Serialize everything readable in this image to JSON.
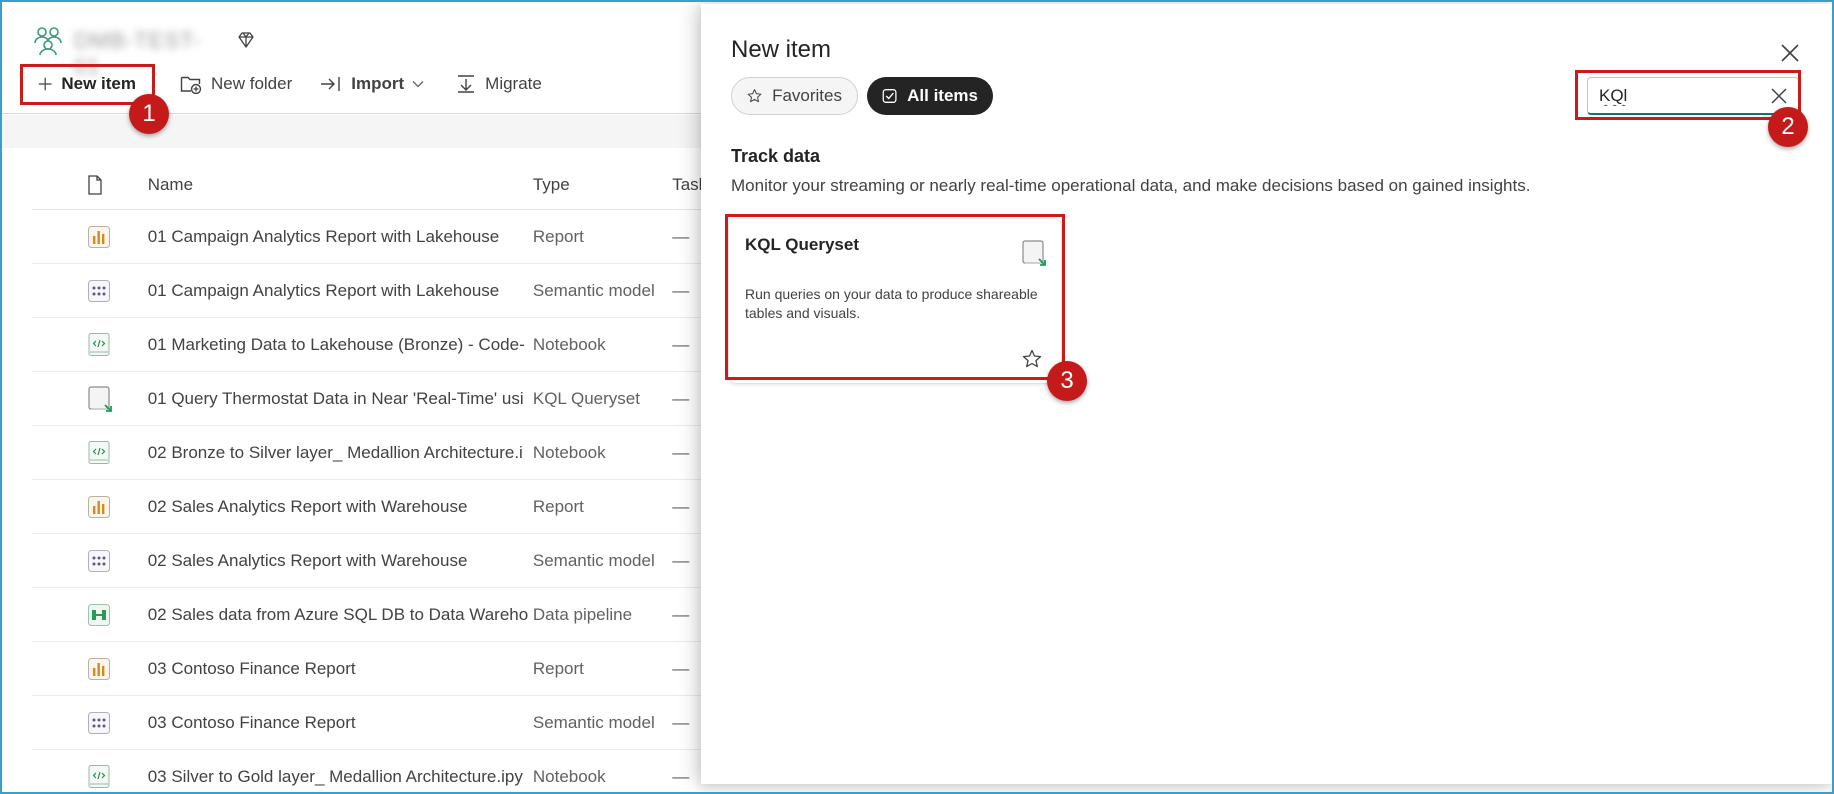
{
  "workspace": {
    "name": "DMB-TEST-01",
    "toolbar": {
      "new_item": "New item",
      "new_folder": "New folder",
      "import": "Import",
      "migrate": "Migrate"
    },
    "table": {
      "headers": {
        "name": "Name",
        "type": "Type",
        "task": "Task"
      },
      "rows": [
        {
          "icon": "report-icon",
          "name": "01 Campaign Analytics Report with Lakehouse",
          "type": "Report",
          "task": "—"
        },
        {
          "icon": "semantic-model-icon",
          "name": "01 Campaign Analytics Report with Lakehouse",
          "type": "Semantic model",
          "task": "—"
        },
        {
          "icon": "notebook-icon",
          "name": "01 Marketing Data to Lakehouse (Bronze) - Code-",
          "type": "Notebook",
          "task": "—"
        },
        {
          "icon": "kql-queryset-icon",
          "name": "01 Query Thermostat Data in Near 'Real-Time' usi",
          "type": "KQL Queryset",
          "task": "—"
        },
        {
          "icon": "notebook-icon",
          "name": "02 Bronze to Silver layer_ Medallion Architecture.i",
          "type": "Notebook",
          "task": "—"
        },
        {
          "icon": "report-icon",
          "name": "02 Sales Analytics Report with Warehouse",
          "type": "Report",
          "task": "—"
        },
        {
          "icon": "semantic-model-icon",
          "name": "02 Sales Analytics Report with Warehouse",
          "type": "Semantic model",
          "task": "—"
        },
        {
          "icon": "data-pipeline-icon",
          "name": "02 Sales data from Azure SQL DB to Data Wareho",
          "type": "Data pipeline",
          "task": "—"
        },
        {
          "icon": "report-icon",
          "name": "03 Contoso Finance Report",
          "type": "Report",
          "task": "—"
        },
        {
          "icon": "semantic-model-icon",
          "name": "03 Contoso Finance Report",
          "type": "Semantic model",
          "task": "—"
        },
        {
          "icon": "notebook-icon",
          "name": "03 Silver to Gold layer_ Medallion Architecture.ipy",
          "type": "Notebook",
          "task": "—"
        }
      ]
    }
  },
  "panel": {
    "title": "New item",
    "filters": {
      "favorites": "Favorites",
      "all_items": "All items"
    },
    "search": {
      "value": "KQl"
    },
    "section": {
      "title": "Track data",
      "description": "Monitor your streaming or nearly real-time operational data, and make decisions based on gained insights."
    },
    "card": {
      "title": "KQL Queryset",
      "description": "Run queries on your data to produce shareable tables and visuals."
    }
  },
  "annotations": {
    "step1": "1",
    "step2": "2",
    "step3": "3"
  },
  "colors": {
    "highlight": "#cc1b1b",
    "accent": "#117865",
    "dark_pill": "#242424"
  }
}
